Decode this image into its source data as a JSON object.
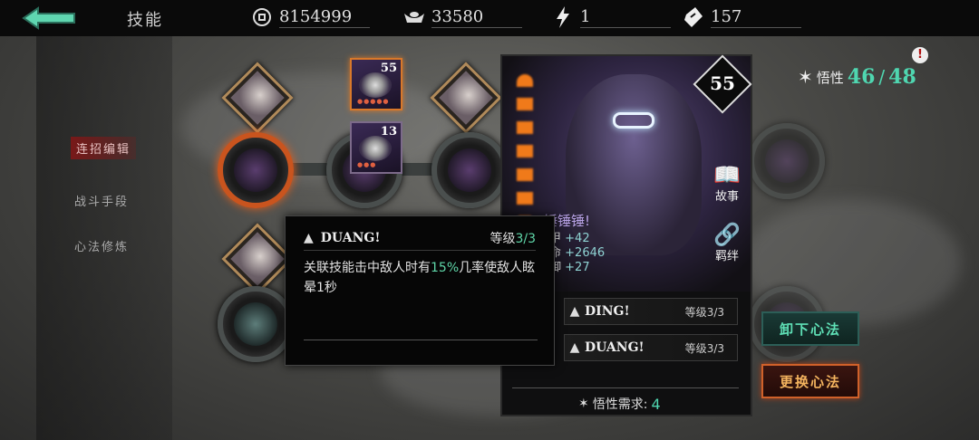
{
  "topbar": {
    "title": "技能",
    "resources": [
      {
        "icon": "coin-icon",
        "value": "8154999"
      },
      {
        "icon": "ingot-icon",
        "value": "33580"
      },
      {
        "icon": "lightning-icon",
        "value": "1"
      },
      {
        "icon": "ticket-icon",
        "value": "157"
      }
    ]
  },
  "side_tabs": [
    "连招编辑",
    "战斗手段",
    "心法修炼"
  ],
  "tree": {
    "item_cards": [
      {
        "level": "55"
      },
      {
        "level": "13"
      }
    ]
  },
  "character": {
    "level": "55",
    "weapon_name": "锤锤锤!",
    "stats": [
      {
        "label": "甲",
        "value": "+42"
      },
      {
        "label": "命",
        "value": "+2646"
      },
      {
        "label": "御",
        "value": "+27"
      }
    ],
    "story_label": "故事",
    "bond_label": "羁绊",
    "skills": [
      {
        "name": "DING!",
        "level_label": "等级",
        "level": "3/3"
      },
      {
        "name": "DUANG!",
        "level_label": "等级",
        "level": "3/3"
      }
    ],
    "requirement_label": "悟性需求:",
    "requirement_value": "4"
  },
  "tooltip": {
    "name": "DUANG!",
    "level_label": "等级",
    "level": "3/3",
    "desc_before": "关联技能击中敌人时有",
    "desc_highlight": "15%",
    "desc_after": "几率使敌人眩晕1秒"
  },
  "wu": {
    "label": "悟性",
    "current": "46",
    "max": "48"
  },
  "buttons": {
    "unequip": "卸下心法",
    "replace": "更换心法"
  },
  "colors": {
    "accent_teal": "#4fd6b0",
    "accent_orange": "#d0612a"
  }
}
